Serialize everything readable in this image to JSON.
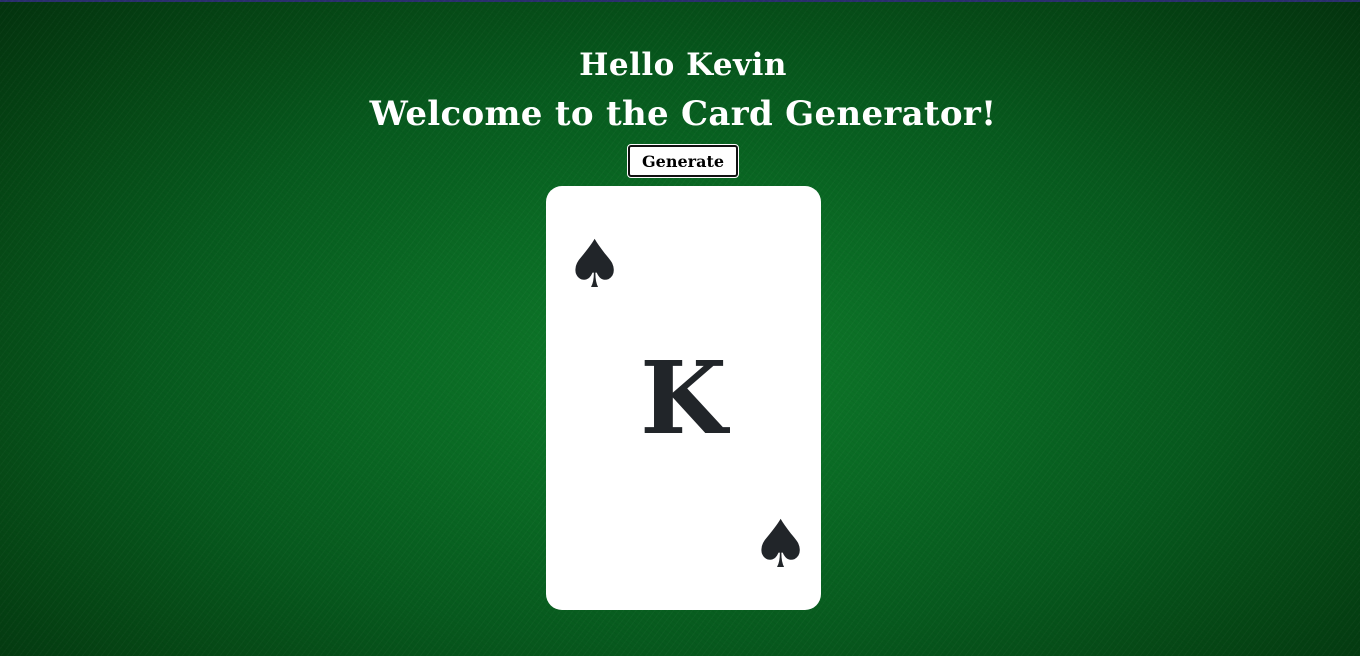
{
  "header": {
    "greeting": "Hello Kevin",
    "welcome": "Welcome to the Card Generator!"
  },
  "controls": {
    "generate_label": "Generate"
  },
  "card": {
    "rank": "K",
    "suit": "spade",
    "suit_symbol": "♠",
    "suit_color": "#212529"
  },
  "colors": {
    "table_green": "#0a6a24",
    "card_background": "#ffffff",
    "text_light": "#ffffff"
  }
}
